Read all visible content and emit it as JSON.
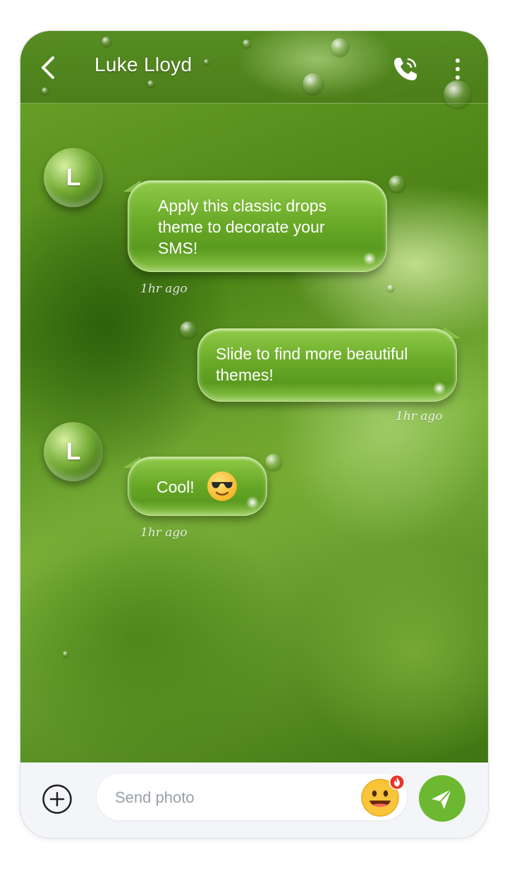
{
  "header": {
    "contact_name": "Luke Lloyd",
    "back_icon": "chevron-left-icon",
    "call_icon": "phone-icon",
    "more_icon": "more-vertical-icon"
  },
  "messages": [
    {
      "direction": "incoming",
      "avatar_letter": "L",
      "text": "Apply this classic drops theme to decorate your SMS!",
      "time": "1hr ago"
    },
    {
      "direction": "outgoing",
      "text": "Slide to find more beautiful themes!",
      "time": "1hr ago"
    },
    {
      "direction": "incoming",
      "avatar_letter": "L",
      "text": "Cool!",
      "emoji": "sunglasses-face-emoji",
      "time": "1hr ago"
    }
  ],
  "composer": {
    "attach_icon": "plus-circle-icon",
    "placeholder": "Send photo",
    "emoji_icon": "grinning-face-icon",
    "emoji_badge_icon": "fire-icon",
    "send_icon": "send-icon"
  },
  "colors": {
    "accent": "#6cb830",
    "bubble": "#6aaa28",
    "footer_bg": "#f3f5f8"
  }
}
